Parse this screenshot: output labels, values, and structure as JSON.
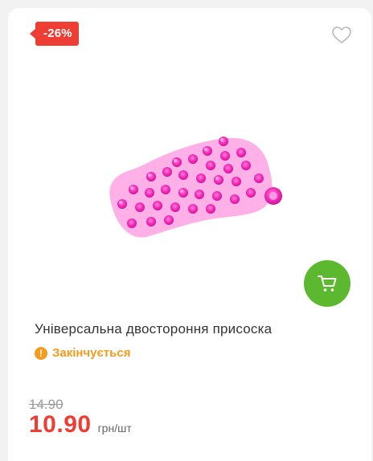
{
  "badge": {
    "discount": "-26%"
  },
  "product": {
    "title": "Універсальна двостороння присоска",
    "stock_status": "Закінчується",
    "stock_icon": "!",
    "old_price": "14.90",
    "new_price": "10.90",
    "unit": "грн/шт"
  },
  "icons": {
    "favorite": "heart-icon",
    "cart": "cart-icon",
    "status": "exclamation-icon"
  },
  "colors": {
    "discount_red": "#ee3d33",
    "cart_green": "#5cb82f",
    "stock_orange": "#f59b1e",
    "product_pink": "#f02bb8"
  }
}
